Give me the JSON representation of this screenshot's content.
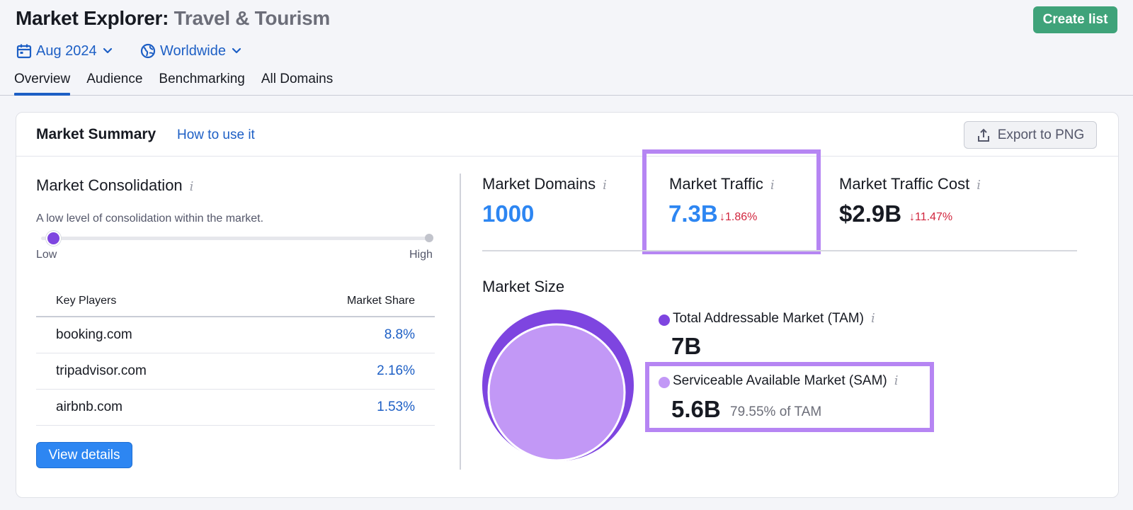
{
  "header": {
    "title_main": "Market Explorer:",
    "title_sub": "Travel & Tourism",
    "create_button": "Create list",
    "date_filter": "Aug 2024",
    "region_filter": "Worldwide",
    "tabs": [
      {
        "label": "Overview",
        "active": true
      },
      {
        "label": "Audience",
        "active": false
      },
      {
        "label": "Benchmarking",
        "active": false
      },
      {
        "label": "All Domains",
        "active": false
      }
    ]
  },
  "summary": {
    "title": "Market Summary",
    "how_to_link": "How to use it",
    "export_button": "Export to PNG",
    "consolidation": {
      "title": "Market Consolidation",
      "description": "A low level of consolidation within the market.",
      "low_label": "Low",
      "high_label": "High",
      "level": 0.02
    },
    "key_players": {
      "header_name": "Key Players",
      "header_share": "Market Share",
      "rows": [
        {
          "domain": "booking.com",
          "share": "8.8%"
        },
        {
          "domain": "tripadvisor.com",
          "share": "2.16%"
        },
        {
          "domain": "airbnb.com",
          "share": "1.53%"
        }
      ]
    },
    "view_details_button": "View details",
    "metrics": {
      "domains": {
        "label": "Market Domains",
        "value": "1000"
      },
      "traffic": {
        "label": "Market Traffic",
        "value": "7.3B",
        "change": "↓1.86%"
      },
      "traffic_cost": {
        "label": "Market Traffic Cost",
        "value": "$2.9B",
        "change": "↓11.47%"
      }
    },
    "market_size": {
      "title": "Market Size",
      "tam": {
        "label": "Total Addressable Market (TAM)",
        "value": "7B"
      },
      "sam": {
        "label": "Serviceable Available Market (SAM)",
        "value": "5.6B",
        "share_of_tam": "79.55% of TAM"
      }
    },
    "colors": {
      "accent_blue": "#1d5fc5",
      "create_green": "#3fa37a",
      "tam_purple": "#7e45e0",
      "sam_purple": "#c298f6",
      "highlight": "#b685f3",
      "negative_red": "#d1253d"
    }
  }
}
